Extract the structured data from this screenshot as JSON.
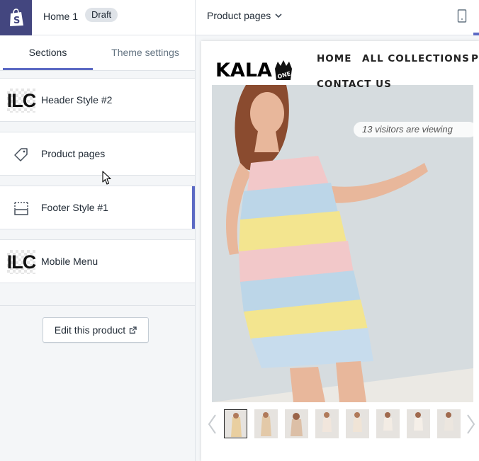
{
  "topbar": {
    "theme_name": "Home 1",
    "badge": "Draft",
    "page_selector": "Product pages",
    "icons": {
      "logo": "shopify-bag-icon",
      "dropdown": "chevron-down-icon",
      "device": "mobile-device-icon"
    }
  },
  "sidebar": {
    "tabs": [
      {
        "label": "Sections",
        "active": true
      },
      {
        "label": "Theme settings",
        "active": false
      }
    ],
    "sections": [
      {
        "label": "Header Style #2",
        "icon": "ilc-thumbnail"
      },
      {
        "label": "Product pages",
        "icon": "tag-icon"
      },
      {
        "label": "Footer Style #1",
        "icon": "footer-layout-icon",
        "selected": true
      },
      {
        "label": "Mobile Menu",
        "icon": "ilc-thumbnail"
      }
    ],
    "ilc_text": "ILC",
    "edit_button": "Edit this product",
    "edit_icon": "external-link-icon"
  },
  "preview": {
    "logo_text": "KALA",
    "logo_badge": "ONE",
    "nav": [
      "HOME",
      "ALL COLLECTIONS",
      "P",
      "CONTACT US"
    ],
    "viewing_text": "13 visitors are viewing",
    "thumbnail_count": 8,
    "active_thumbnail": 1
  },
  "colors": {
    "shopify_purple": "#43467f",
    "accent": "#5c6ac4",
    "border": "#dfe3e8",
    "sidebar_bg": "#f4f6f8"
  }
}
